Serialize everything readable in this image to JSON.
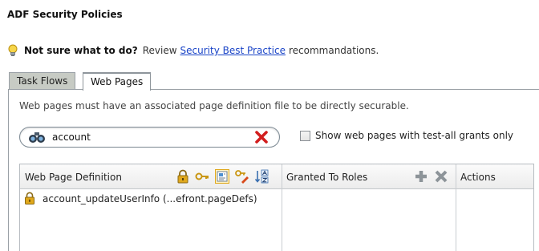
{
  "page": {
    "title": "ADF Security Policies"
  },
  "hint": {
    "question": "Not sure what to do?",
    "prefix": "Review",
    "link": "Security Best Practice",
    "suffix": "recommandations.",
    "icon": "lightbulb-icon"
  },
  "tabs": [
    {
      "label": "Task Flows",
      "selected": false
    },
    {
      "label": "Web Pages",
      "selected": true
    }
  ],
  "description": "Web pages must have an associated page definition file to be directly securable.",
  "search": {
    "value": "account",
    "icon": "binoculars-icon",
    "clear_icon": "clear-red-x-icon"
  },
  "filter": {
    "label": "Show web pages with test-all grants only",
    "checked": false
  },
  "table": {
    "columns": {
      "definition": "Web Page Definition",
      "roles": "Granted To Roles",
      "actions": "Actions"
    },
    "definition_tools": [
      "lock-icon",
      "key-icon",
      "page-definition-icon",
      "key-pen-icon",
      "sort-az-icon"
    ],
    "roles_tools": [
      "add-icon",
      "delete-icon"
    ],
    "rows": [
      {
        "name": "account_updateUserInfo (...efront.pageDefs)",
        "icon": "lock-icon"
      }
    ]
  },
  "colors": {
    "link": "#1a44c7",
    "clear_red": "#d21e1e",
    "tab_inactive": "#c7cbc4",
    "lock_gold": "#e0a81c"
  }
}
